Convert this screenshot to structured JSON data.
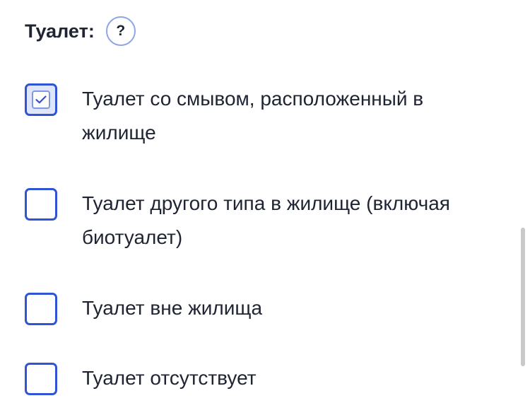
{
  "header": {
    "title": "Туалет:",
    "help_label": "?"
  },
  "options": [
    {
      "label": "Туалет со смывом, расположенный в жилище",
      "checked": true
    },
    {
      "label": "Туалет другого типа в жилище (включая биотуалет)",
      "checked": false
    },
    {
      "label": "Туалет вне жилища",
      "checked": false
    },
    {
      "label": "Туалет отсутствует",
      "checked": false
    }
  ],
  "colors": {
    "accent": "#2f55d4",
    "checked_fill": "#dfe6fb",
    "text": "#1f2433"
  }
}
